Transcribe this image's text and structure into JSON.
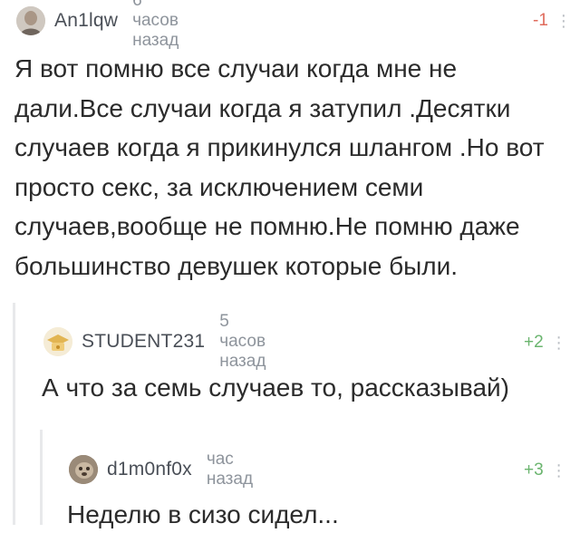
{
  "comments": [
    {
      "username": "An1lqw",
      "time": "6 часов назад",
      "rating": "-1",
      "lines": [
        "Я вот помню все случаи когда мне не",
        "дали.Все случаи когда я затупил .Десятки",
        "случаев когда я прикинулся шлангом .Но вот",
        "просто секс, за исключением семи",
        "случаев,вообще не помню.Не помню даже",
        "большинство девушек которые были."
      ],
      "avatar_icon": "user-photo-avatar",
      "rating_color": "#e06b5c"
    },
    {
      "username": "STUDENT231",
      "time": "5 часов назад",
      "rating": "+2",
      "lines": [
        "А что за семь случаев то, рассказывай)"
      ],
      "avatar_icon": "graduation-cap-avatar",
      "rating_color": "#6bb56f"
    },
    {
      "username": "d1m0nf0x",
      "time": "час назад",
      "rating": "+3",
      "lines": [
        "Неделю в сизо сидел..."
      ],
      "avatar_icon": "animal-photo-avatar",
      "rating_color": "#6bb56f"
    }
  ],
  "menu_icon": "more-vertical-icon"
}
